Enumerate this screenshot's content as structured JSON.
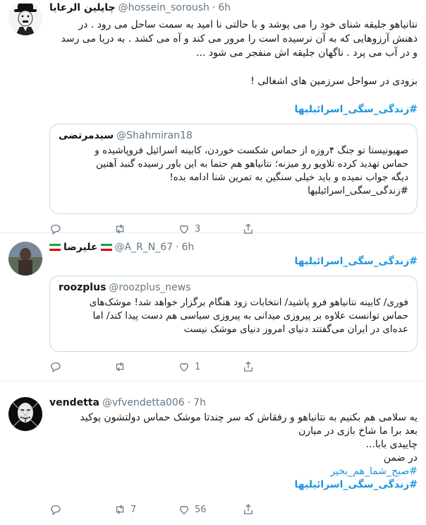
{
  "tweets": [
    {
      "name": "چاپلین الرعایا",
      "handle": "@hossein_soroush",
      "time": "6h",
      "text_lines": [
        "نتانیاهو جلیقه شنای خود را می پوشد و با حالتی نا امید به سمت ساحل می رود . در",
        "ذهنش آرزوهایی که به آن نرسیده است را مرور می کند و آه می کشد . به دریا می رسد",
        "و در آب می پرد . ناگهان جلیقه اش منفجر می شود ..."
      ],
      "text_line2": "بزودی در سواحل سرزمین های اشغالی !",
      "hashtag": "#زندگی_سگی_اسرائیلیها",
      "quote": {
        "name": "سیدمرتضی",
        "handle": "@Shahmiran18",
        "text_lines": [
          "صهیونیستا تو جنگ ۴روزه از حماس شکست خوردن، کابینه اسرائیل فروپاشیده و",
          "حماس تهدید کرده تلاویو رو میزنه؛ نتانیاهو هم حتما به این باور رسیده گنبد آهنین",
          "دیگه جواب نمیده و باید خیلی سنگین به تمرین شنا ادامه بده!"
        ],
        "hashtag": "#زندگی_سگی_اسرائیلیها"
      },
      "actions": {
        "reply": "",
        "retweet": "",
        "like": "3"
      }
    },
    {
      "name": "علیرضا",
      "handle": "@A_R_N_67",
      "time": "6h",
      "hashtag": "#زندگی_سگی_اسرائیلیها",
      "quote": {
        "name": "roozplus",
        "handle": "@roozplus_news",
        "text_lines": [
          "فوری/ کابینه نتانیاهو فرو پاشید/ انتخابات زود هنگام برگزار خواهد شد! موشک‌های",
          "حماس توانست علاوه بر پیروزی میدانی به پیروزی سیاسی هم دست پیدا کند/ اما",
          "عده‌ای در ایران می‌گفتند دنیای امروز دنیای موشک نیست"
        ]
      },
      "actions": {
        "reply": "",
        "retweet": "",
        "like": "1"
      }
    },
    {
      "name": "vendetta",
      "handle": "@vfvendetta006",
      "time": "7h",
      "text_lines": [
        "یه سلامی هم بکنیم به نتانیاهو و رفقاش که سر چندتا موشک حماس دولتشون پوکید",
        "بعد برا ما شاخ بازی در میارن",
        "چاییدی بابا...",
        "در ضمن"
      ],
      "hashtag_small": "#صبح_شما_هم_بخیر",
      "hashtag": "#زندگی_سگی_اسرائیلیها",
      "actions": {
        "reply": "",
        "retweet": "7",
        "like": "56"
      }
    }
  ],
  "colors": {
    "link": "#1b95e0",
    "muted": "#657786",
    "border": "#e6ecf0"
  },
  "icons": [
    "reply-icon",
    "retweet-icon",
    "like-icon",
    "share-icon"
  ]
}
